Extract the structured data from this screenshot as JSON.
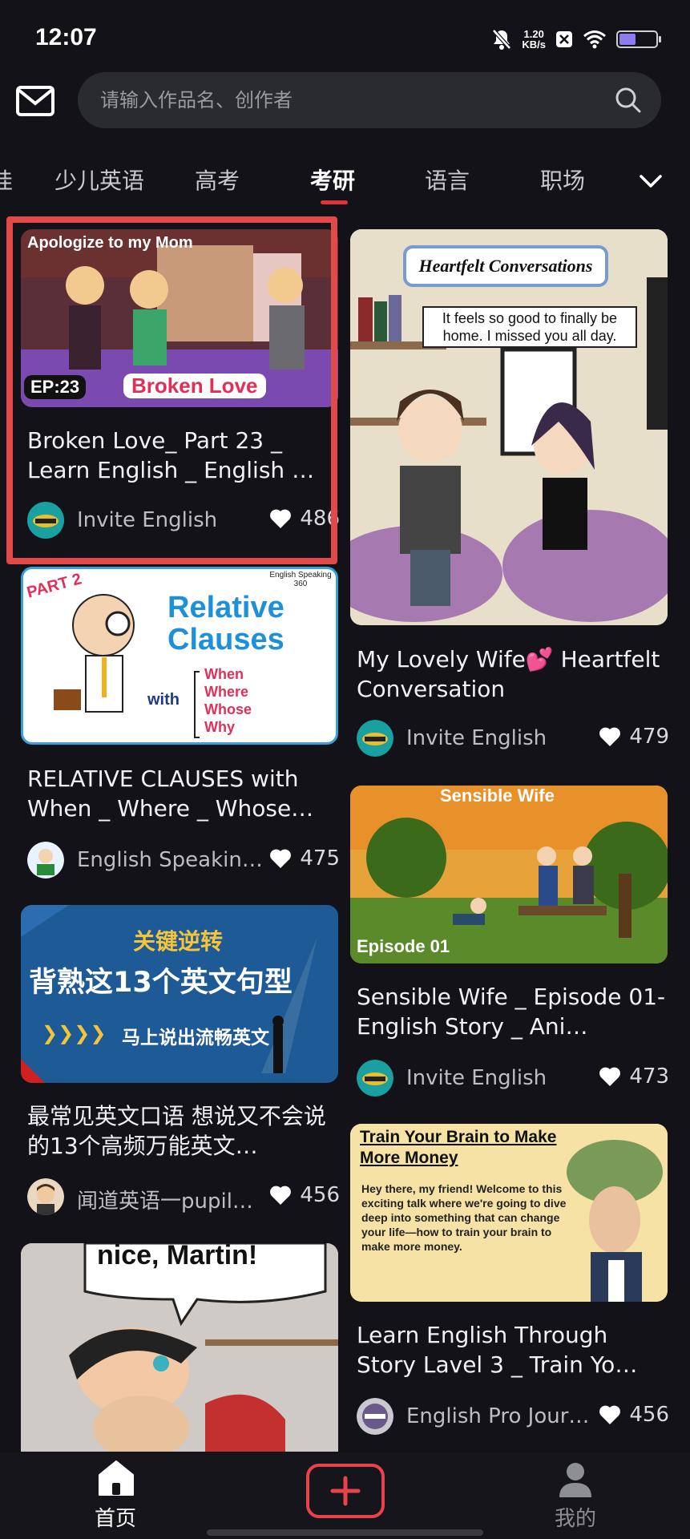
{
  "status_bar": {
    "time": "12:07",
    "net_speed_value": "1.20",
    "net_speed_unit": "KB/s"
  },
  "search": {
    "placeholder": "请输入作品名、创作者"
  },
  "tabs": [
    "娃",
    "少儿英语",
    "高考",
    "考研",
    "语言",
    "职场"
  ],
  "active_tab": "考研",
  "feed": {
    "left": [
      {
        "title": "Broken Love_ Part 23 _ Learn English _ English …",
        "author": "Invite English",
        "likes": "486",
        "thumb_text": [
          "Apologize to my Mom",
          "EP:23",
          "Broken Love"
        ]
      },
      {
        "title": "RELATIVE CLAUSES with When _ Where _ Whose…",
        "author": "English Speakin…",
        "likes": "475",
        "thumb_text": [
          "PART 2",
          "English Speaking 360",
          "Relative",
          "Clauses",
          "with",
          "When",
          "Where",
          "Whose",
          "Why"
        ]
      },
      {
        "title": "最常见英文口语 想说又不会说的13个高频万能英文…",
        "author": "闻道英语一pupil…",
        "likes": "456",
        "thumb_text": [
          "关键逆转",
          "背熟这13个英文句型",
          "马上说出流畅英文"
        ]
      },
      {
        "thumb_text": [
          "nice, Martin!"
        ]
      }
    ],
    "right": [
      {
        "title": "My Lovely Wife💕 Heartfelt Conversation",
        "author": "Invite English",
        "likes": "479",
        "thumb_text": [
          "Heartfelt Conversations",
          "It feels so good to finally be home. I missed you all day."
        ]
      },
      {
        "title": "Sensible Wife _ Episode 01- English Story _ Ani…",
        "author": "Invite English",
        "likes": "473",
        "thumb_text": [
          "Sensible Wife",
          "Episode 01"
        ]
      },
      {
        "title": "Learn English Through Story Lavel 3 _ Train Yo…",
        "author": "English Pro Jour…",
        "likes": "456",
        "thumb_text": [
          "Train Your Brain to Make More Money",
          "Hey there, my friend! Welcome to this exciting talk where we're going to dive deep into something that can change your life—how to train your brain to make more money."
        ]
      }
    ]
  },
  "bottom_nav": {
    "home": "首页",
    "me": "我的"
  },
  "colors": {
    "accent": "#e2333c",
    "background": "#121218"
  }
}
